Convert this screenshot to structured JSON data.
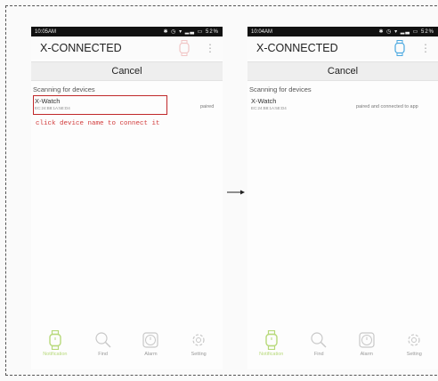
{
  "left": {
    "status_time": "10:05AM",
    "battery": "52%",
    "app_title": "X-CONNECTED",
    "cancel_label": "Cancel",
    "scanning_label": "Scanning for devices",
    "device": {
      "name": "X-Watch",
      "mac": "EC:24:B8:1A:5E:D4",
      "status": "paired"
    },
    "hint": "click device name to connect it"
  },
  "right": {
    "status_time": "10:04AM",
    "battery": "52%",
    "app_title": "X-CONNECTED",
    "cancel_label": "Cancel",
    "scanning_label": "Scanning for devices",
    "device": {
      "name": "X-Watch",
      "mac": "EC:24:B8:1A:5E:D4",
      "status": "paired and connected to app"
    }
  },
  "nav": {
    "notification": "Notification",
    "find": "Find",
    "alarm": "Alarm",
    "setting": "Setting"
  },
  "colors": {
    "accent_green": "#b7d97a",
    "hint_red": "#d23b3b",
    "watch_blue": "#4aa8e0"
  }
}
